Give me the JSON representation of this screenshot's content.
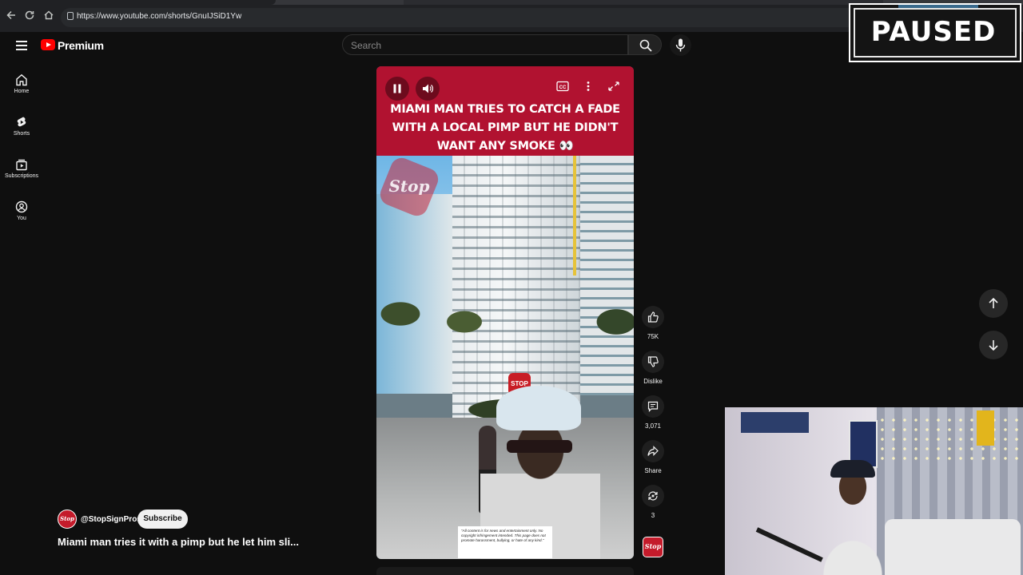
{
  "browser": {
    "url": "https://www.youtube.com/shorts/GnuIJSiD1Yw"
  },
  "overlay": {
    "paused_text": "PAUSED"
  },
  "masthead": {
    "logo_text": "Premium",
    "search_placeholder": "Search"
  },
  "guide": {
    "items": [
      {
        "label": "Home",
        "icon": "home-icon"
      },
      {
        "label": "Shorts",
        "icon": "shorts-icon"
      },
      {
        "label": "Subscriptions",
        "icon": "subscriptions-icon"
      },
      {
        "label": "You",
        "icon": "you-icon"
      }
    ]
  },
  "video": {
    "caption": "MIAMI MAN TRIES TO CATCH A FADE WITH A LOCAL PIMP BUT HE DIDN'T WANT ANY SMOKE 👀",
    "watermark": "Stop",
    "street_sign": "STOP",
    "disclaimer": "\"All content is for news and entertainment only. No copyright infringement intended. This page does not promote harassment, bullying, or hate of any kind.\""
  },
  "actions": {
    "like_count": "75K",
    "dislike_label": "Dislike",
    "comment_count": "3,071",
    "share_label": "Share",
    "remix_count": "3"
  },
  "channel": {
    "handle": "@StopSignPros",
    "avatar_text": "Stop",
    "subscribe_label": "Subscribe"
  },
  "short": {
    "title": "Miami man tries it with a pimp but he let him sli..."
  },
  "colors": {
    "accent": "#ff0000",
    "caption_band": "#b11230",
    "background": "#0f0f0f"
  }
}
